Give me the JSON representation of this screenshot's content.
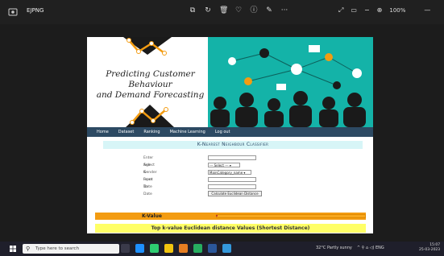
{
  "titlebar": {
    "filename": "EJPNG",
    "zoom": "100%",
    "tool_icons": [
      "crop-icon",
      "rotate-icon",
      "delete-icon",
      "favorite-icon",
      "info-icon",
      "edit-icon",
      "more-icon"
    ],
    "tool_glyphs": [
      "⧉",
      "↻",
      "🗑",
      "♡",
      "ⓘ",
      "✎",
      "···"
    ],
    "right_icons": [
      "expand-icon",
      "fullscreen-icon",
      "zoom-out-icon",
      "zoom-in-icon"
    ],
    "right_glyphs": [
      "⤢",
      "▭",
      "−",
      "⊕"
    ],
    "window_controls": [
      "—",
      "▢"
    ]
  },
  "banner": {
    "title_line1": "Predicting Customer Behaviour",
    "title_line2": "and Demand Forecasting"
  },
  "nav": {
    "items": [
      "Home",
      "Dataset",
      "Ranking",
      "Machine Learning",
      "Log out"
    ]
  },
  "knn": {
    "heading": "K-Nearest Neighbour Classifier",
    "form": {
      "age_label": "Enter Age",
      "age_value": "",
      "gender_label": "Select Gender",
      "gender_value": "--- Select --- ▾",
      "kinput_label": "K-Input",
      "kinput_value": "MainCategory_name ▾",
      "from_label": "From Date",
      "from_value": "",
      "to_label": "To Date",
      "to_value": ""
    },
    "calc_button": "Calculate Euclidean Distance",
    "kvalue_label": "K-Value",
    "result_heading": "Top k-value Euclidean distance Values (Shortest Distance)"
  },
  "taskbar": {
    "search_placeholder": "Type here to search",
    "weather": "32°C  Partly sunny",
    "tray_icons": "^ ⚲ ⌂ ◁) ENG",
    "time": "15:07",
    "date": "25-03-2023"
  },
  "colors": {
    "teal": "#14b3a8",
    "nav": "#2d4a63",
    "orange": "#f39c12",
    "yellow": "#ffff66"
  }
}
